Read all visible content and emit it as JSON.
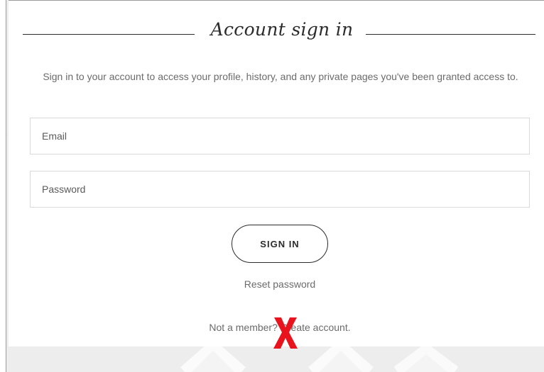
{
  "card": {
    "title": "Account sign in",
    "intro": "Sign in to your account to access your profile, history, and any private pages you've been granted access to."
  },
  "form": {
    "email_placeholder": "Email",
    "password_placeholder": "Password",
    "signin_label": "SIGN IN"
  },
  "links": {
    "reset_password": "Reset password",
    "not_member": "Not a member?",
    "create_account": "Create account."
  },
  "marker": {
    "icon": "red-x-mark-icon",
    "color": "#e8131c"
  }
}
